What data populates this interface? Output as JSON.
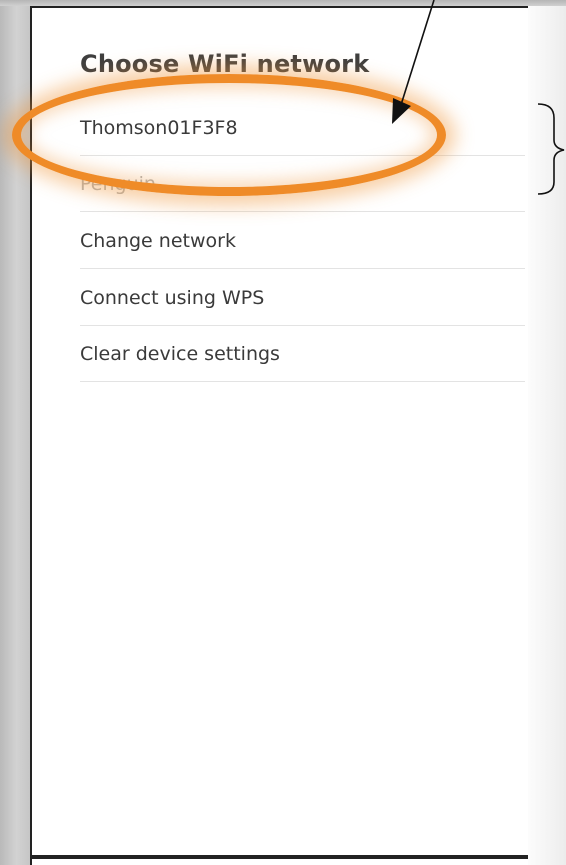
{
  "screen": {
    "title": "Choose WiFi network",
    "items": [
      {
        "label": "Thomson01F3F8"
      },
      {
        "label": "Penguin"
      },
      {
        "label": "Change network"
      },
      {
        "label": "Connect using WPS"
      },
      {
        "label": "Clear device settings"
      }
    ]
  },
  "annotation": {
    "highlight_color": "#ef8b28",
    "arrow_color": "#111111"
  }
}
